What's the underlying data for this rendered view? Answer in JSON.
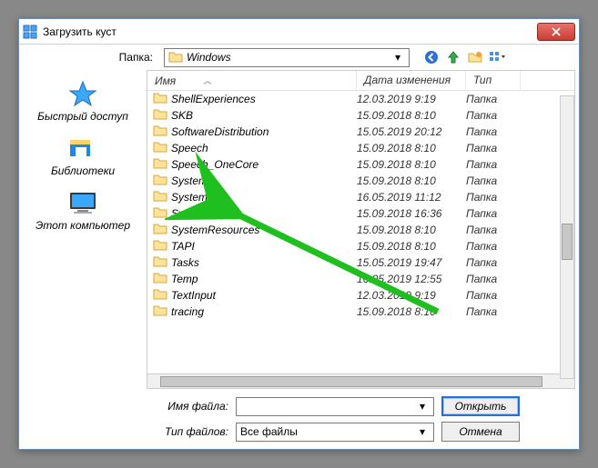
{
  "title": "Загрузить куст",
  "folder_label": "Папка:",
  "folder_name": "Windows",
  "places": {
    "quick_access": "Быстрый доступ",
    "libraries": "Библиотеки",
    "this_pc": "Этот компьютер"
  },
  "columns": {
    "name": "Имя",
    "date": "Дата изменения",
    "type": "Тип"
  },
  "rows": [
    {
      "name": "ShellExperiences",
      "date": "12.03.2019 9:19",
      "type": "Папка"
    },
    {
      "name": "SKB",
      "date": "15.09.2018 8:10",
      "type": "Папка"
    },
    {
      "name": "SoftwareDistribution",
      "date": "15.05.2019 20:12",
      "type": "Папка"
    },
    {
      "name": "Speech",
      "date": "15.09.2018 8:10",
      "type": "Папка"
    },
    {
      "name": "Speech_OneCore",
      "date": "15.09.2018 8:10",
      "type": "Папка"
    },
    {
      "name": "System",
      "date": "15.09.2018 8:10",
      "type": "Папка"
    },
    {
      "name": "System32",
      "date": "16.05.2019 11:12",
      "type": "Папка"
    },
    {
      "name": "SystemApps",
      "date": "15.09.2018 16:36",
      "type": "Папка"
    },
    {
      "name": "SystemResources",
      "date": "15.09.2018 8:10",
      "type": "Папка"
    },
    {
      "name": "TAPI",
      "date": "15.09.2018 8:10",
      "type": "Папка"
    },
    {
      "name": "Tasks",
      "date": "15.05.2019 19:47",
      "type": "Папка"
    },
    {
      "name": "Temp",
      "date": "16.05.2019 12:55",
      "type": "Папка"
    },
    {
      "name": "TextInput",
      "date": "12.03.2019 9:19",
      "type": "Папка"
    },
    {
      "name": "tracing",
      "date": "15.09.2018 8:10",
      "type": "Папка"
    }
  ],
  "filename_label": "Имя файла:",
  "filetype_label": "Тип файлов:",
  "filetype_value": "Все файлы",
  "open_btn": "Открыть",
  "cancel_btn": "Отмена"
}
